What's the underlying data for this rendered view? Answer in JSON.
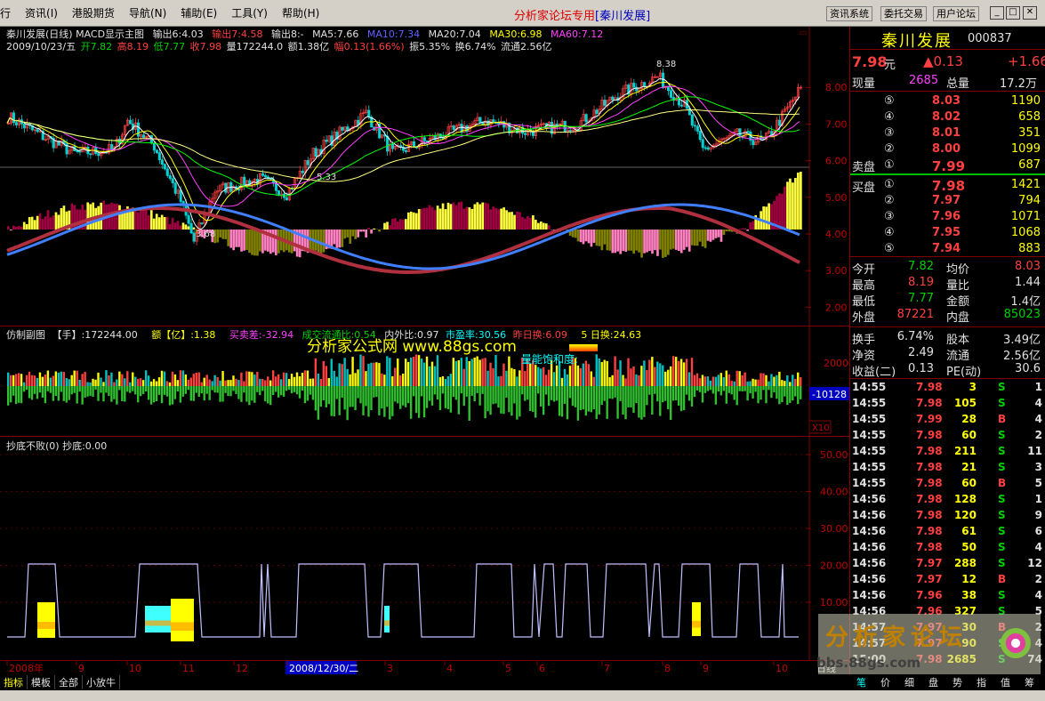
{
  "menu": {
    "items": [
      "行",
      "资讯(I)",
      "港股期货",
      "导航(N)",
      "辅助(E)",
      "工具(Y)",
      "帮助(H)"
    ],
    "title_main": "分析家论坛专用",
    "title_stock": "[秦川发展]",
    "buttons": [
      "资讯系统",
      "委托交易",
      "用户论坛"
    ]
  },
  "price_pane": {
    "title": "秦川发展(日线) MACD显示主图",
    "out6": "输出6:4.03",
    "out7": "输出7:4.58",
    "out8": "输出8:-",
    "ma5": "MA5:7.66",
    "ma10": "MA10:7.34",
    "ma20": "MA20:7.04",
    "ma30": "MA30:6.98",
    "ma60": "MA60:7.12",
    "date": "2009/10/23/五",
    "open": "开7.82",
    "high": "高8.19",
    "low": "低7.77",
    "close": "收7.98",
    "vol": "量172244.0",
    "amt": "额1.38亿",
    "chg": "幅0.13(1.66%)",
    "amp": "振5.35%",
    "turn": "换6.74%",
    "float": "流通2.56亿",
    "annot_high": "8.38",
    "annot_low": "3.68",
    "annot_mid": "5.33",
    "axis": [
      "8.00",
      "7.00",
      "6.00",
      "5.00",
      "4.00",
      "3.00",
      "2.00"
    ]
  },
  "vol_pane": {
    "label1": "仿制副图",
    "label2": "【手】:172244.00",
    "label3": "额【亿】:1.38",
    "label4": "买卖差:-32.94",
    "label5": "成交流通比:0.54",
    "label6": "内外比:0.97",
    "label7": "市盈率:30.56",
    "label8": "昨日换:6.09",
    "label9": "5 日换:24.63",
    "watermark": "分析家公式网 www.88gs.com",
    "sat": "量能饱和度:",
    "axis_top": "20000",
    "axis_mid": "10000",
    "cur": "-10128",
    "mult": "X10"
  },
  "ind_pane": {
    "title": "抄底不败(0) 抄底:0.00",
    "axis": [
      "50.00",
      "40.00",
      "30.00",
      "20.00",
      "10.00"
    ]
  },
  "xaxis": {
    "labels": [
      "2008年",
      "9",
      "10",
      "11",
      "12",
      "2008/12/30/二",
      "3",
      "4",
      "5",
      "6",
      "7",
      "8",
      "9",
      "10"
    ],
    "period": "日线"
  },
  "quote": {
    "name": "秦川发展",
    "code": "000837",
    "price": "7.98",
    "unit": "元",
    "change": "▲0.13",
    "change2": "+1.66",
    "now_vol_label": "现量",
    "now_vol": "2685",
    "tot_vol_label": "总量",
    "tot_vol": "17.2万",
    "asks": [
      {
        "lvl": "⑤",
        "price": "8.03",
        "vol": "1190"
      },
      {
        "lvl": "④",
        "price": "8.02",
        "vol": "658"
      },
      {
        "lvl": "③",
        "price": "8.01",
        "vol": "351"
      },
      {
        "lvl": "②",
        "price": "8.00",
        "vol": "1099"
      },
      {
        "lvl": "①",
        "price": "7.99",
        "vol": "687"
      }
    ],
    "ask_label": "卖盘",
    "bid_label": "买盘",
    "bids": [
      {
        "lvl": "①",
        "price": "7.98",
        "vol": "1421"
      },
      {
        "lvl": "②",
        "price": "7.97",
        "vol": "794"
      },
      {
        "lvl": "③",
        "price": "7.96",
        "vol": "1071"
      },
      {
        "lvl": "④",
        "price": "7.95",
        "vol": "1068"
      },
      {
        "lvl": "⑤",
        "price": "7.94",
        "vol": "883"
      }
    ],
    "stats1": [
      {
        "k": "今开",
        "v": "7.82",
        "k2": "均价",
        "v2": "8.03"
      },
      {
        "k": "最高",
        "v": "8.19",
        "k2": "量比",
        "v2": "1.44"
      },
      {
        "k": "最低",
        "v": "7.77",
        "k2": "金额",
        "v2": "1.4亿"
      },
      {
        "k": "外盘",
        "v": "87221",
        "k2": "内盘",
        "v2": "85023"
      }
    ],
    "stats2": [
      {
        "k": "换手",
        "v": "6.74%",
        "k2": "股本",
        "v2": "3.49亿"
      },
      {
        "k": "净资",
        "v": "2.49",
        "k2": "流通",
        "v2": "2.56亿"
      },
      {
        "k": "收益(二)",
        "v": "0.13",
        "k2": "PE(动)",
        "v2": "30.6"
      }
    ],
    "ticks": [
      {
        "t": "14:55",
        "p": "7.98",
        "v": "3",
        "s": "S",
        "n": "1"
      },
      {
        "t": "14:55",
        "p": "7.98",
        "v": "105",
        "s": "S",
        "n": "4"
      },
      {
        "t": "14:55",
        "p": "7.99",
        "v": "28",
        "s": "B",
        "n": "4"
      },
      {
        "t": "14:55",
        "p": "7.98",
        "v": "60",
        "s": "S",
        "n": "2"
      },
      {
        "t": "14:55",
        "p": "7.98",
        "v": "211",
        "s": "S",
        "n": "11"
      },
      {
        "t": "14:55",
        "p": "7.98",
        "v": "21",
        "s": "S",
        "n": "3"
      },
      {
        "t": "14:55",
        "p": "7.98",
        "v": "60",
        "s": "B",
        "n": "5"
      },
      {
        "t": "14:56",
        "p": "7.98",
        "v": "128",
        "s": "S",
        "n": "1"
      },
      {
        "t": "14:56",
        "p": "7.98",
        "v": "120",
        "s": "S",
        "n": "9"
      },
      {
        "t": "14:56",
        "p": "7.98",
        "v": "61",
        "s": "S",
        "n": "6"
      },
      {
        "t": "14:56",
        "p": "7.98",
        "v": "50",
        "s": "S",
        "n": "4"
      },
      {
        "t": "14:56",
        "p": "7.97",
        "v": "288",
        "s": "S",
        "n": "12"
      },
      {
        "t": "14:56",
        "p": "7.97",
        "v": "12",
        "s": "B",
        "n": "2"
      },
      {
        "t": "14:56",
        "p": "7.96",
        "v": "38",
        "s": "S",
        "n": "4"
      },
      {
        "t": "14:56",
        "p": "7.96",
        "v": "327",
        "s": "S",
        "n": "5"
      },
      {
        "t": "14:57",
        "p": "7.97",
        "v": "30",
        "s": "B",
        "n": "2"
      },
      {
        "t": "14:57",
        "p": "7.97",
        "v": "90",
        "s": "S",
        "n": "4"
      },
      {
        "t": "15:00",
        "p": "7.98",
        "v": "2685",
        "s": "S",
        "n": "74"
      }
    ]
  },
  "tabs": [
    "指标",
    "模板",
    "全部",
    "小放牛"
  ],
  "rtabs": [
    "笔",
    "价",
    "细",
    "盘",
    "势",
    "指",
    "值",
    "筹"
  ],
  "watermark2": "分析家论坛",
  "watermark3": "bbs.88gs.com",
  "colors": {
    "up": "#ff4040",
    "down": "#00d0d0",
    "yellow": "#ffff00",
    "grid": "#800000"
  }
}
